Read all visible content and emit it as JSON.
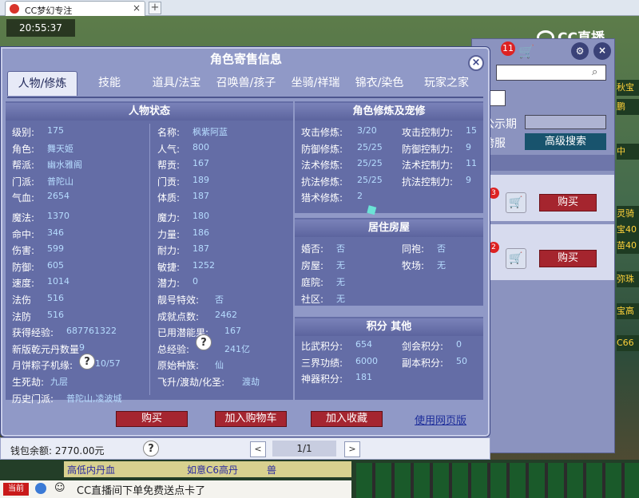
{
  "browser": {
    "tab_title": "CC梦幻专注",
    "close": "×",
    "new_tab": "+"
  },
  "game": {
    "time": "20:55:37",
    "cc_logo": "CC直播",
    "notify_count": "11"
  },
  "right_panel": {
    "announce_label": "公示期",
    "cross_label": "跨服",
    "adv_search": "高级搜索",
    "buy1": "购买",
    "buy2": "购买",
    "badge1": "3",
    "badge2": "2"
  },
  "side_chips": [
    "秋宝",
    "鹏",
    "中",
    "灵骑",
    "宝40",
    "苗40",
    "弥珠宝",
    "宝高",
    "C66"
  ],
  "dialog": {
    "title": "角色寄售信息",
    "close": "×",
    "tabs": [
      "人物/修炼",
      "技能",
      "道具/法宝",
      "召唤兽/孩子",
      "坐骑/祥瑞",
      "锦衣/染色",
      "玩家之家"
    ],
    "left_header": "人物状态",
    "right_header": "角色修炼及宠修",
    "house_header": "居住房屋",
    "score_header": "积分 其他",
    "left_col1": [
      {
        "label": "级别:",
        "value": "175"
      },
      {
        "label": "角色:",
        "value": "舞天姬"
      },
      {
        "label": "帮派:",
        "value": "幽水雅阁"
      },
      {
        "label": "门派:",
        "value": "普陀山"
      },
      {
        "label": "气血:",
        "value": "2654"
      },
      {
        "label": "魔法:",
        "value": "1370"
      },
      {
        "label": "命中:",
        "value": "346"
      },
      {
        "label": "伤害:",
        "value": "599"
      },
      {
        "label": "防御:",
        "value": "605"
      },
      {
        "label": "速度:",
        "value": "1014"
      },
      {
        "label": "法伤",
        "value": "516"
      },
      {
        "label": "法防",
        "value": "516"
      },
      {
        "label": "获得经验:",
        "value": "687761322"
      },
      {
        "label": "新版乾元丹数量",
        "value": "9"
      },
      {
        "label": "月饼粽子机缘:",
        "value": "10/57"
      },
      {
        "label": "生死劫:",
        "value": "九层"
      },
      {
        "label": "历史门派:",
        "value": "普陀山,凌波城"
      }
    ],
    "left_col2": [
      {
        "label": "名称:",
        "value": "枫紫阿蓝"
      },
      {
        "label": "人气:",
        "value": "800"
      },
      {
        "label": "帮贡:",
        "value": "167"
      },
      {
        "label": "门贡:",
        "value": "189"
      },
      {
        "label": "体质:",
        "value": "187"
      },
      {
        "label": "魔力:",
        "value": "180"
      },
      {
        "label": "力量:",
        "value": "186"
      },
      {
        "label": "耐力:",
        "value": "187"
      },
      {
        "label": "敏捷:",
        "value": "1252"
      },
      {
        "label": "潜力:",
        "value": "0"
      },
      {
        "label": "靓号特效:",
        "value": "否"
      },
      {
        "label": "成就点数:",
        "value": "2462"
      },
      {
        "label": "已用潜能果:",
        "value": "167"
      },
      {
        "label": "总经验:",
        "value": "241亿"
      },
      {
        "label": "原始种族:",
        "value": "仙"
      },
      {
        "label": "飞升/渡劫/化圣:",
        "value": "渡劫"
      }
    ],
    "help_mark": "?",
    "cult_left": [
      {
        "label": "攻击修炼:",
        "value": "3/20"
      },
      {
        "label": "防御修炼:",
        "value": "25/25"
      },
      {
        "label": "法术修炼:",
        "value": "25/25"
      },
      {
        "label": "抗法修炼:",
        "value": "25/25"
      },
      {
        "label": "猎术修炼:",
        "value": "2"
      }
    ],
    "cult_right": [
      {
        "label": "攻击控制力:",
        "value": "15"
      },
      {
        "label": "防御控制力:",
        "value": "9"
      },
      {
        "label": "法术控制力:",
        "value": "11"
      },
      {
        "label": "抗法控制力:",
        "value": "9"
      }
    ],
    "house_left": [
      {
        "label": "婚否:",
        "value": "否"
      },
      {
        "label": "房屋:",
        "value": "无"
      },
      {
        "label": "庭院:",
        "value": "无"
      },
      {
        "label": "社区:",
        "value": "无"
      }
    ],
    "house_right": [
      {
        "label": "同袍:",
        "value": "否"
      },
      {
        "label": "牧场:",
        "value": "无"
      }
    ],
    "score_left": [
      {
        "label": "比武积分:",
        "value": "654"
      },
      {
        "label": "三界功绩:",
        "value": "6000"
      },
      {
        "label": "神器积分:",
        "value": "181"
      }
    ],
    "score_right": [
      {
        "label": "剑会积分:",
        "value": "0"
      },
      {
        "label": "副本积分:",
        "value": "50"
      }
    ],
    "buttons": {
      "buy": "购买",
      "cart": "加入购物车",
      "fav": "加入收藏",
      "web": "使用网页版"
    }
  },
  "footer": {
    "wallet": "钱包余额: 2770.00元",
    "help": "?",
    "prev": "<",
    "page": "1/1",
    "next": ">"
  },
  "taskbar": {
    "item1": "高低内丹血",
    "item2": "如意C6高丹",
    "item3": "兽",
    "chat_badge": "当前",
    "chat_text": "CC直播间下单免费送点卡了"
  }
}
